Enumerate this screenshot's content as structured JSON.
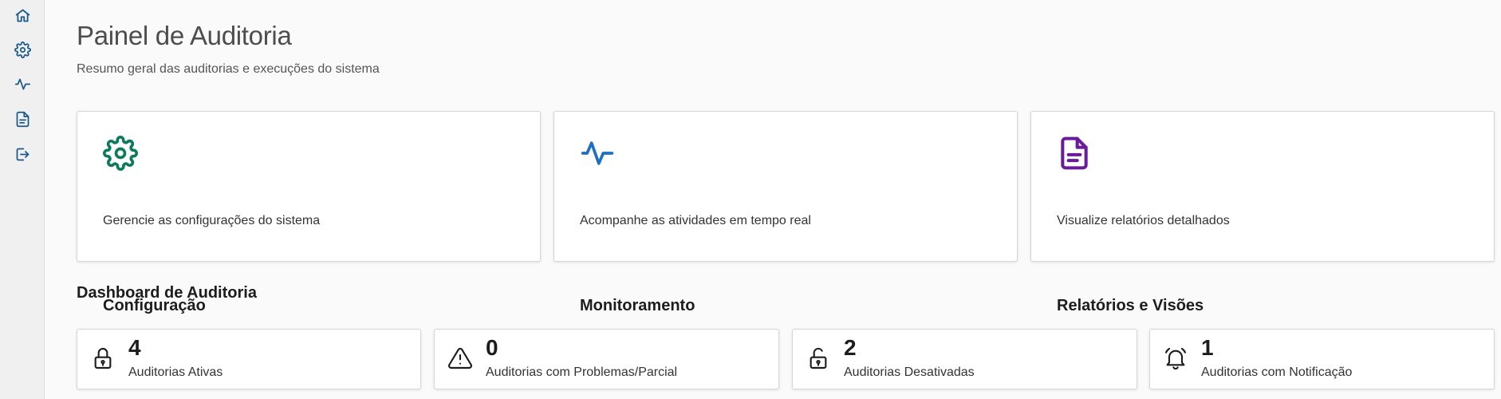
{
  "sidebar": {
    "items": [
      {
        "icon": "home-icon",
        "label": ""
      },
      {
        "icon": "gear-icon",
        "label": ""
      },
      {
        "icon": "activity-icon",
        "label": ""
      },
      {
        "icon": "document-icon",
        "label": ""
      },
      {
        "icon": "logout-icon",
        "label": ""
      }
    ],
    "icon_color": "#1a5a8a"
  },
  "header": {
    "title": "Painel de Auditoria",
    "subtitle": "Resumo geral das auditorias e execuções do sistema"
  },
  "cards": [
    {
      "icon": "gear-icon",
      "icon_color": "#0e7a5c",
      "title": "Configuração",
      "description": "Gerencie as configurações do sistema"
    },
    {
      "icon": "activity-icon",
      "icon_color": "#1f6fc0",
      "title": "Monitoramento",
      "description": "Acompanhe as atividades em tempo real"
    },
    {
      "icon": "document-icon",
      "icon_color": "#6a1b9a",
      "title": "Relatórios e Visões",
      "description": "Visualize relatórios detalhados"
    }
  ],
  "dashboard": {
    "title": "Dashboard de Auditoria",
    "stats": [
      {
        "icon": "lock-icon",
        "value": "4",
        "label": "Auditorias Ativas"
      },
      {
        "icon": "warning-icon",
        "value": "0",
        "label": "Auditorias com Problemas/Parcial"
      },
      {
        "icon": "unlock-icon",
        "value": "2",
        "label": "Auditorias Desativadas"
      },
      {
        "icon": "bell-icon",
        "value": "1",
        "label": "Auditorias com Notificação"
      }
    ]
  }
}
